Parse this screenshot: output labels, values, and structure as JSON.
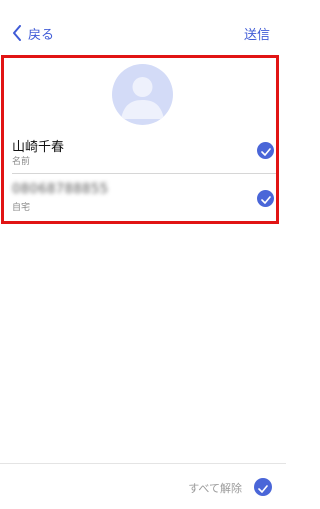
{
  "nav": {
    "back_label": "戻る",
    "back_icon": "chevron-left-icon",
    "send_label": "送信"
  },
  "contact": {
    "avatar_icon": "person-silhouette-icon",
    "name": "山崎千春",
    "name_caption": "名前",
    "phone": "08068788855",
    "phone_caption": "自宅",
    "name_selected": true,
    "phone_selected": true
  },
  "footer": {
    "clear_all_label": "すべて解除",
    "selected": true
  },
  "colors": {
    "accent": "#3f5bd6",
    "check": "#4a66d8",
    "highlight_border": "#e11414",
    "avatar_bg": "#d3dbf7"
  }
}
